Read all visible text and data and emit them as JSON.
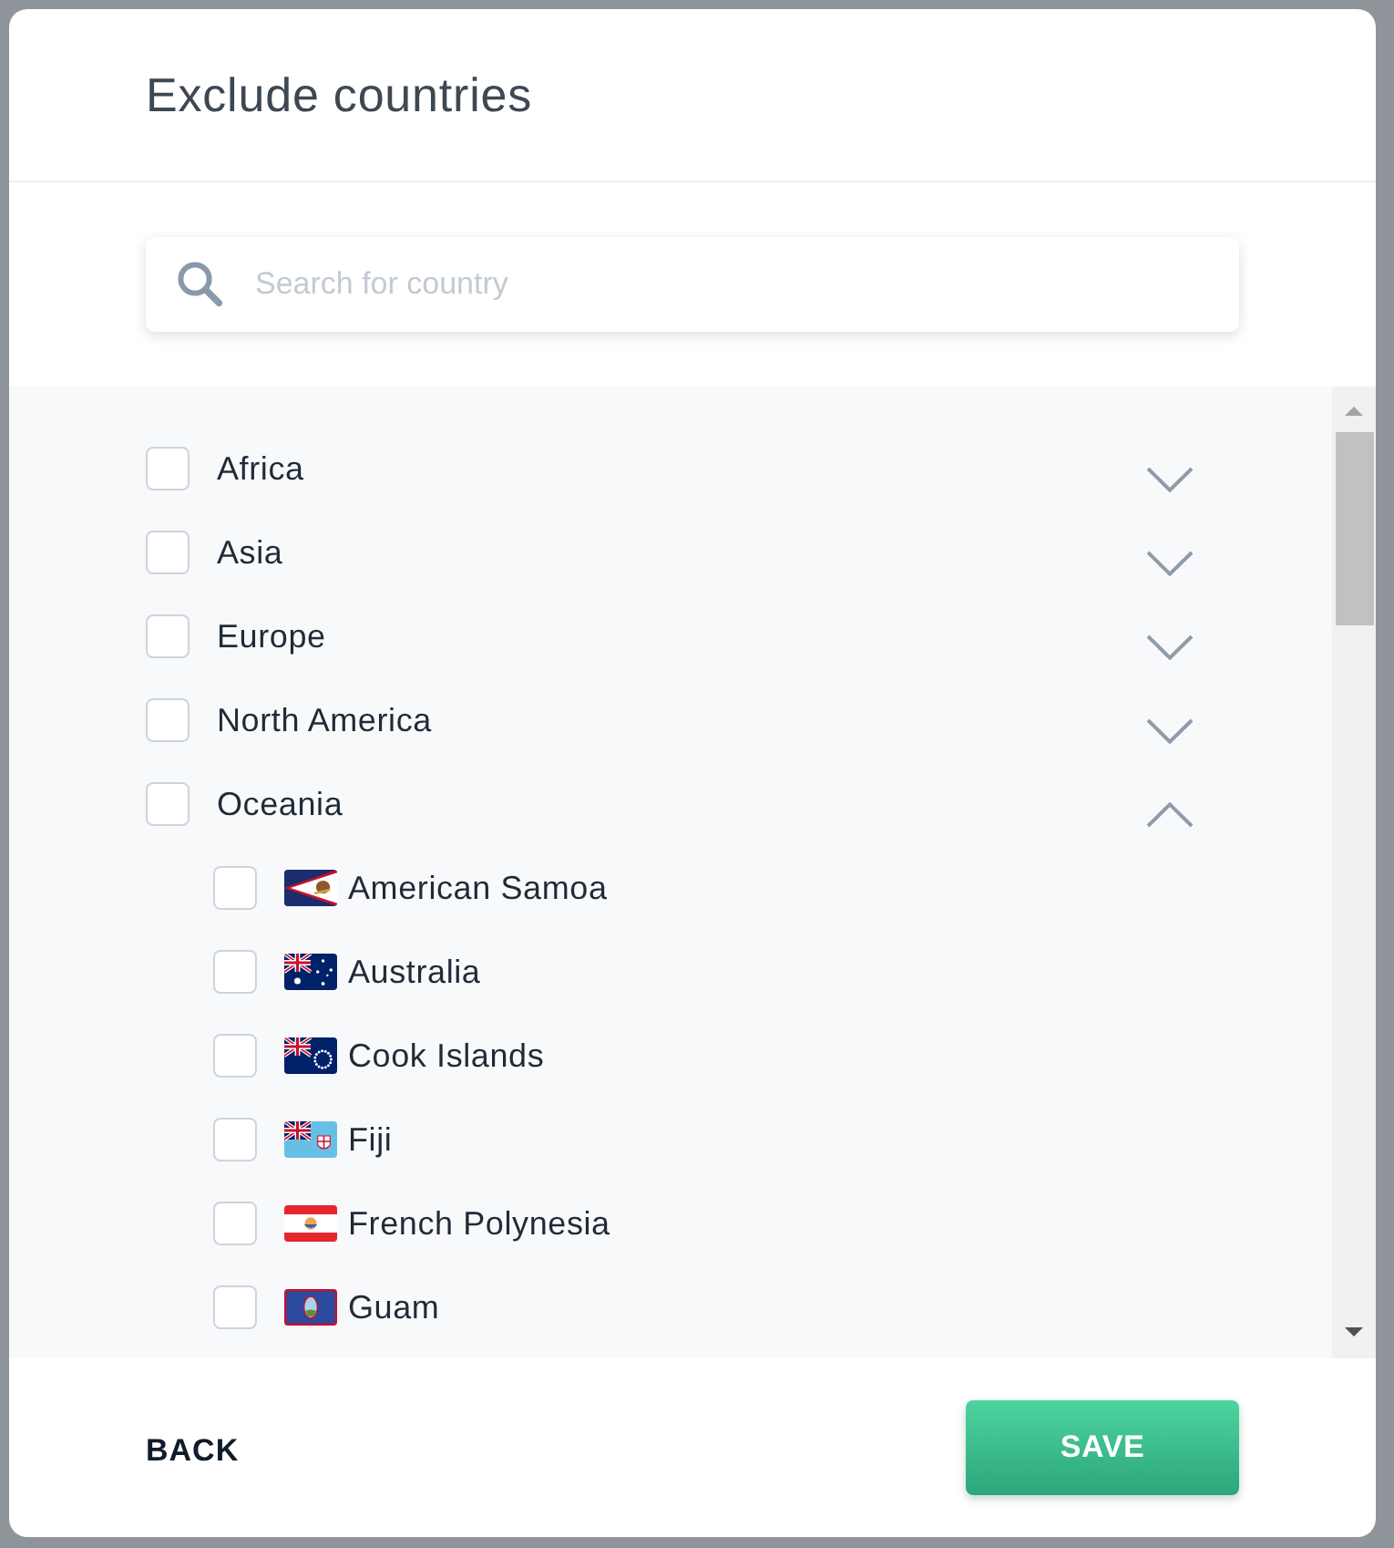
{
  "dialog": {
    "title": "Exclude countries"
  },
  "search": {
    "placeholder": "Search for country"
  },
  "regions": [
    {
      "label": "Africa",
      "checked": false,
      "expanded": false
    },
    {
      "label": "Asia",
      "checked": false,
      "expanded": false
    },
    {
      "label": "Europe",
      "checked": false,
      "expanded": false
    },
    {
      "label": "North America",
      "checked": false,
      "expanded": false
    },
    {
      "label": "Oceania",
      "checked": false,
      "expanded": true,
      "children": [
        {
          "label": "American Samoa",
          "checked": false
        },
        {
          "label": "Australia",
          "checked": false
        },
        {
          "label": "Cook Islands",
          "checked": false
        },
        {
          "label": "Fiji",
          "checked": false
        },
        {
          "label": "French Polynesia",
          "checked": false
        },
        {
          "label": "Guam",
          "checked": false
        }
      ]
    }
  ],
  "footer": {
    "back": "BACK",
    "save": "SAVE"
  }
}
